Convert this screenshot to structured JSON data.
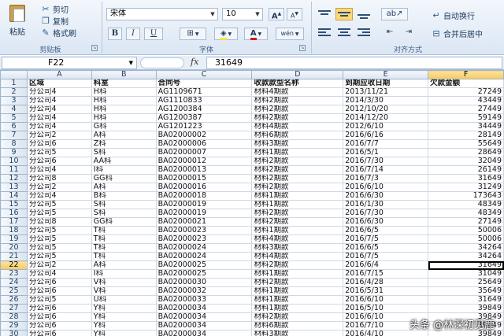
{
  "ribbon": {
    "clipboard": {
      "paste_label": "粘贴",
      "cut_label": "剪切",
      "copy_label": "复制",
      "format_painter_label": "格式刷",
      "group_label": "剪贴板"
    },
    "font": {
      "font_name": "宋体",
      "font_size": "10",
      "grow_label": "A",
      "shrink_label": "A",
      "bold_label": "B",
      "italic_label": "I",
      "underline_label": "U",
      "font_color_label": "A",
      "phonetic_label": "wén",
      "group_label": "字体",
      "font_color": "#d21a1a",
      "fill_color": "#f7e43c"
    },
    "alignment": {
      "wrap_text_label": "自动换行",
      "merge_center_label": "合并后居中",
      "group_label": "对齐方式"
    }
  },
  "formula_bar": {
    "name_box": "F22",
    "fx_label": "fx",
    "formula": "31649"
  },
  "sheet": {
    "column_headers": [
      "A",
      "B",
      "C",
      "D",
      "E",
      "F"
    ],
    "header_row": [
      "区域",
      "科室",
      "合同号",
      "收款款型名称",
      "到期应收日期",
      "欠款金额"
    ],
    "rows": [
      [
        "分公司4",
        "H科",
        "AG1109671",
        "材料4期款",
        "2013/11/21",
        "27249"
      ],
      [
        "分公司4",
        "H科",
        "AG1110833",
        "材料2期款",
        "2014/3/30",
        "43449"
      ],
      [
        "分公司4",
        "H科",
        "AG1200384",
        "材料2期款",
        "2012/10/20",
        "27449"
      ],
      [
        "分公司4",
        "H科",
        "AG1200387",
        "材料2期款",
        "2014/12/20",
        "59149"
      ],
      [
        "分公司4",
        "G科",
        "AG1201223",
        "材料4期款",
        "2012/6/10",
        "34449"
      ],
      [
        "分公司2",
        "A科",
        "BA02000002",
        "材料6期款",
        "2016/6/16",
        "28149"
      ],
      [
        "分公司6",
        "Z科",
        "BA02000006",
        "材料3期款",
        "2016/7/7",
        "55649"
      ],
      [
        "分公司5",
        "S科",
        "BA02000007",
        "材料1期款",
        "2016/5/1",
        "28649"
      ],
      [
        "分公司6",
        "AA科",
        "BA02000012",
        "材料2期款",
        "2016/7/30",
        "32049"
      ],
      [
        "分公司4",
        "I科",
        "BA02000013",
        "材料2期款",
        "2016/7/14",
        "26149"
      ],
      [
        "分公司8",
        "GG科",
        "BA02000015",
        "材料2期款",
        "2016/7/3",
        "31649"
      ],
      [
        "分公司2",
        "A科",
        "BA02000016",
        "材料2期款",
        "2016/6/10",
        "31249"
      ],
      [
        "分公司4",
        "B科",
        "BA02000018",
        "材料1期款",
        "2016/6/30",
        "173643"
      ],
      [
        "分公司5",
        "S科",
        "BA02000019",
        "材料1期款",
        "2016/1/30",
        "48349"
      ],
      [
        "分公司5",
        "S科",
        "BA02000019",
        "材料2期款",
        "2016/7/30",
        "48349"
      ],
      [
        "分公司8",
        "GG科",
        "BA02000021",
        "材料2期款",
        "2016/6/30",
        "27149"
      ],
      [
        "分公司5",
        "T科",
        "BA02000023",
        "材料1期款",
        "2016/6/5",
        "50006"
      ],
      [
        "分公司5",
        "T科",
        "BA02000023",
        "材料4期款",
        "2016/7/5",
        "50006"
      ],
      [
        "分公司5",
        "T科",
        "BA02000024",
        "材料3期款",
        "2016/6/5",
        "34264"
      ],
      [
        "分公司5",
        "T科",
        "BA02000024",
        "材料4期款",
        "2016/7/5",
        "34264"
      ],
      [
        "分公司2",
        "A科",
        "BA02000025",
        "材料2期款",
        "2016/6/4",
        "31649"
      ],
      [
        "分公司4",
        "I科",
        "BA02000025",
        "材料1期款",
        "2016/7/15",
        "31049"
      ],
      [
        "分公司6",
        "V科",
        "BA02000030",
        "材料2期款",
        "2016/4/28",
        "25649"
      ],
      [
        "分公司6",
        "V科",
        "BA02000032",
        "材料1期款",
        "2016/5/31",
        "35649"
      ],
      [
        "分公司5",
        "U科",
        "BA02000033",
        "材料1期款",
        "2016/6/10",
        "31649"
      ],
      [
        "分公司6",
        "Y科",
        "BA02000034",
        "材料1期款",
        "2016/5/10",
        "39849"
      ],
      [
        "分公司6",
        "Y科",
        "BA02000034",
        "材料2期款",
        "2016/6/10",
        "39849"
      ],
      [
        "分公司6",
        "Y科",
        "BA02000034",
        "材料6期款",
        "2016/7/10",
        "39849"
      ],
      [
        "分公司6",
        "Y科",
        "BA02000034",
        "材料3期款",
        "2016/4/10",
        "39849"
      ]
    ],
    "selected_row": 22,
    "selected_column": "F"
  },
  "watermark": "头条 @林深初见鹿"
}
